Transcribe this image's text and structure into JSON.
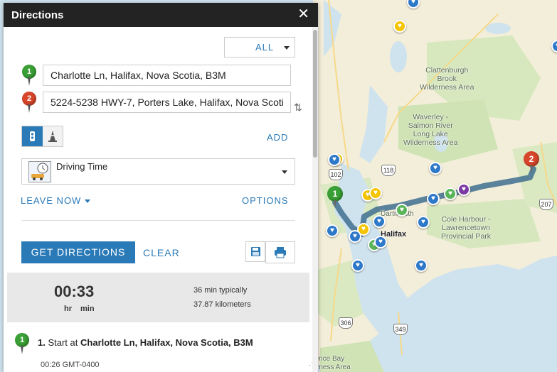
{
  "panel": {
    "title": "Directions",
    "close_glyph": "✕",
    "mode_select": {
      "value": "ALL"
    },
    "stops": [
      {
        "marker": "1",
        "value": "Charlotte Ln, Halifax, Nova Scotia, B3M"
      },
      {
        "marker": "2",
        "value": "5224-5238 HWY-7, Porters Lake, Halifax, Nova Scoti"
      }
    ],
    "swap_glyph": "⇅",
    "add_label": "ADD",
    "travel_mode": {
      "label": "Driving Time"
    },
    "leave_now_label": "LEAVE NOW",
    "options_label": "OPTIONS",
    "get_directions_label": "GET DIRECTIONS",
    "clear_label": "CLEAR",
    "summary": {
      "time": "00:33",
      "unit_hr": "hr",
      "unit_min": "min",
      "typical": "36 min typically",
      "distance": "37.87 kilometers"
    },
    "step1": {
      "marker": "1",
      "number": "1.",
      "prefix": "Start at",
      "location": "Charlotte Ln, Halifax, Nova Scotia, B3M",
      "time": "00:26 GMT-0400"
    },
    "resize_glyph": "⋰"
  },
  "map": {
    "labels": {
      "clattenburgh": "Clattenburgh\nBrook\nWilderness Area",
      "waverley": "Waverley -\nSalmon River\nLong Lake\nWilderness Area",
      "cole_harbour": "Cole Harbour -\nLawrencetown\nProvincial Park",
      "halifax": "Halifax",
      "dartmouth": "Dartmouth",
      "bottom": "Terence Bay\nWilderness Area"
    },
    "shields": [
      "102",
      "118",
      "207",
      "306",
      "349"
    ],
    "markers": [
      "1",
      "2"
    ],
    "colors": {
      "land": "#f3eed9",
      "park": "#cfe3b4",
      "water": "#cfe3ee",
      "route": "#3f6f8f",
      "accent": "#2a7ab8"
    }
  }
}
